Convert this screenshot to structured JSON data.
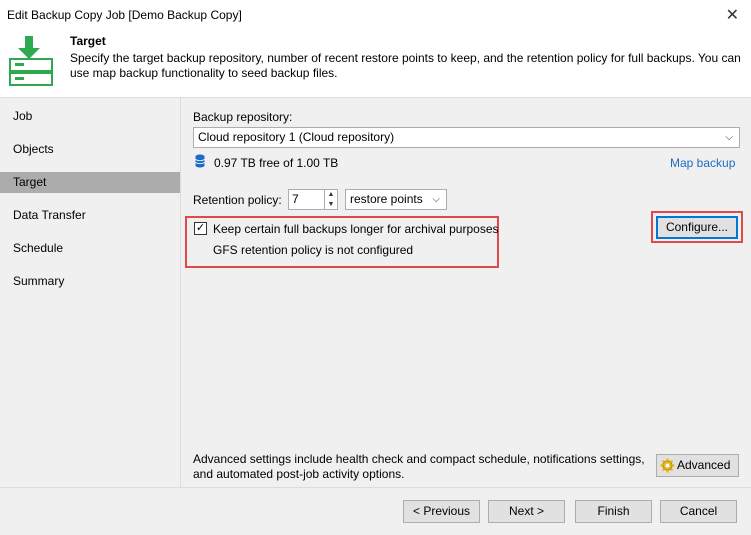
{
  "window": {
    "title": "Edit Backup Copy Job [Demo Backup Copy]",
    "close_glyph": "✕"
  },
  "header": {
    "title": "Target",
    "description": "Specify the target backup repository, number of recent restore points to keep, and the retention policy for full backups. You can use map backup functionality to seed backup files.",
    "icon": "backup-target-icon"
  },
  "sidebar": {
    "items": [
      {
        "label": "Job",
        "active": false
      },
      {
        "label": "Objects",
        "active": false
      },
      {
        "label": "Target",
        "active": true
      },
      {
        "label": "Data Transfer",
        "active": false
      },
      {
        "label": "Schedule",
        "active": false
      },
      {
        "label": "Summary",
        "active": false
      }
    ]
  },
  "main": {
    "repository_label": "Backup repository:",
    "repository_value": "Cloud repository 1 (Cloud repository)",
    "storage_info": "0.97 TB free of 1.00 TB",
    "map_backup_link": "Map backup",
    "retention_label": "Retention policy:",
    "retention_value": "7",
    "retention_unit": "restore points",
    "gfs_checkbox_label": "Keep certain full backups longer for archival purposes",
    "gfs_checked": true,
    "gfs_status": "GFS retention policy is not configured",
    "configure_button": "Configure...",
    "advanced_text": "Advanced settings include health check and compact schedule, notifications settings, and automated post-job activity options.",
    "advanced_button": "Advanced"
  },
  "footer": {
    "previous": "< Previous",
    "next": "Next >",
    "finish": "Finish",
    "cancel": "Cancel"
  },
  "colors": {
    "highlight_red": "#e0484c",
    "link_blue": "#1a6dc4",
    "icon_green": "#2fa84f",
    "sidebar_active": "#acacac"
  }
}
